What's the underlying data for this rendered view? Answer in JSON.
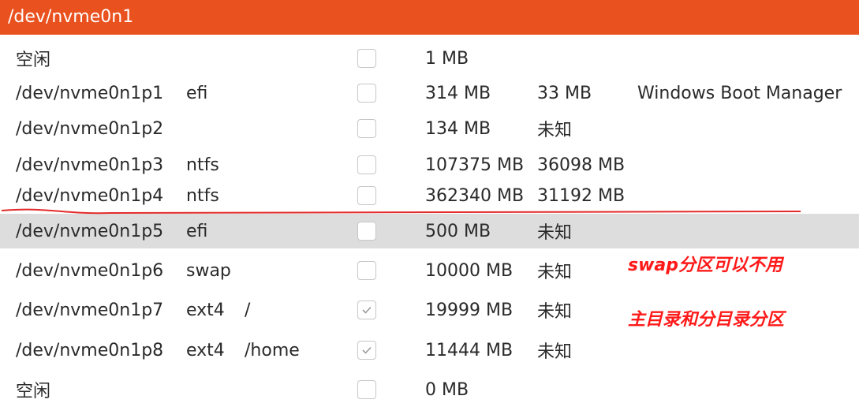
{
  "header": {
    "title": "/dev/nvme0n1"
  },
  "rows": [
    {
      "device": "空闲",
      "fs": "",
      "mount": "",
      "checked": false,
      "size": "1 MB",
      "used": "",
      "system": ""
    },
    {
      "device": "/dev/nvme0n1p1",
      "fs": "efi",
      "mount": "",
      "checked": false,
      "size": "314 MB",
      "used": "33 MB",
      "system": "Windows Boot Manager"
    },
    {
      "device": "/dev/nvme0n1p2",
      "fs": "",
      "mount": "",
      "checked": false,
      "size": "134 MB",
      "used": "未知",
      "system": ""
    },
    {
      "device": "/dev/nvme0n1p3",
      "fs": "ntfs",
      "mount": "",
      "checked": false,
      "size": "107375 MB",
      "used": "36098 MB",
      "system": ""
    },
    {
      "device": "/dev/nvme0n1p4",
      "fs": "ntfs",
      "mount": "",
      "checked": false,
      "size": "362340 MB",
      "used": "31192 MB",
      "system": ""
    },
    {
      "device": "/dev/nvme0n1p5",
      "fs": "efi",
      "mount": "",
      "checked": false,
      "size": "500 MB",
      "used": "未知",
      "system": "",
      "selected": true
    },
    {
      "device": "/dev/nvme0n1p6",
      "fs": "swap",
      "mount": "",
      "checked": false,
      "size": "10000 MB",
      "used": "未知",
      "system": ""
    },
    {
      "device": "/dev/nvme0n1p7",
      "fs": "ext4",
      "mount": "/",
      "checked": true,
      "size": "19999 MB",
      "used": "未知",
      "system": ""
    },
    {
      "device": "/dev/nvme0n1p8",
      "fs": "ext4",
      "mount": "/home",
      "checked": true,
      "size": "11444 MB",
      "used": "未知",
      "system": ""
    },
    {
      "device": "空闲",
      "fs": "",
      "mount": "",
      "checked": false,
      "size": "0 MB",
      "used": "",
      "system": ""
    }
  ],
  "annotations": {
    "swap_note": "swap分区可以不用",
    "dir_note": "主目录和分目录分区",
    "color": "#ff1a1a"
  },
  "colors": {
    "header": "#e9511f",
    "selected_row": "#dddddd"
  }
}
